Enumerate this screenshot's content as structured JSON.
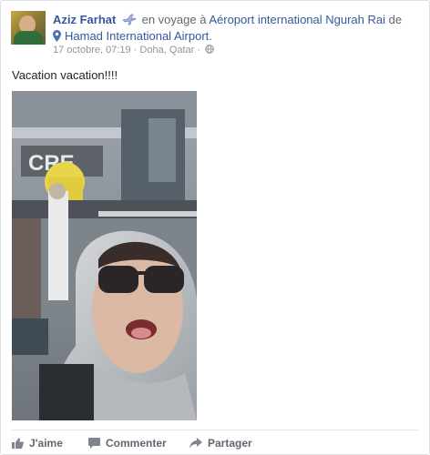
{
  "post": {
    "author": "Aziz Farhat",
    "activity_text": "en voyage à",
    "destination": "Aéroport international Ngurah Rai",
    "from_text": "de",
    "origin": "Hamad International Airport",
    "origin_suffix": ".",
    "timestamp": "17 octobre, 07:19",
    "separator": "·",
    "location": "Doha, Qatar",
    "body": "Vacation vacation!!!!",
    "photo_sign_text": "CRE"
  },
  "actions": {
    "like_label": "J'aime",
    "comment_label": "Commenter",
    "share_label": "Partager"
  },
  "icons": {
    "travel": "airplane-icon",
    "place": "map-pin-icon",
    "privacy": "globe-icon",
    "like": "thumbs-up-icon",
    "comment": "speech-bubble-icon",
    "share": "share-arrow-icon"
  },
  "colors": {
    "link": "#365899",
    "meta": "#90949c",
    "action": "#616770"
  }
}
